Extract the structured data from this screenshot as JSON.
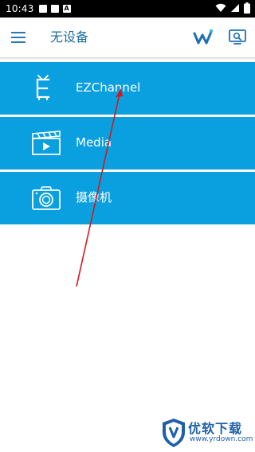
{
  "status_bar": {
    "time": "10:43",
    "icons": [
      "notification-square-icon",
      "notification-square-icon",
      "text-notification-icon",
      "wifi-icon",
      "signal-icon",
      "battery-icon"
    ],
    "text_notification_glyph": "A"
  },
  "app_bar": {
    "title": "无设备",
    "menu_icon": "hamburger-menu-icon",
    "actions": [
      "w-logo-icon",
      "screen-cast-icon"
    ],
    "accent_color": "#1b6f9e"
  },
  "menu_items": [
    {
      "label": "EZChannel",
      "icon": "tv-icon"
    },
    {
      "label": "Media",
      "icon": "clapperboard-icon"
    },
    {
      "label": "摄像机",
      "icon": "camera-icon"
    }
  ],
  "item_background_color": "#0aa0e0",
  "annotation": {
    "type": "arrow",
    "color": "#d11a1a"
  },
  "watermark": {
    "name": "优软下载",
    "url": "www.yrdown.com"
  }
}
